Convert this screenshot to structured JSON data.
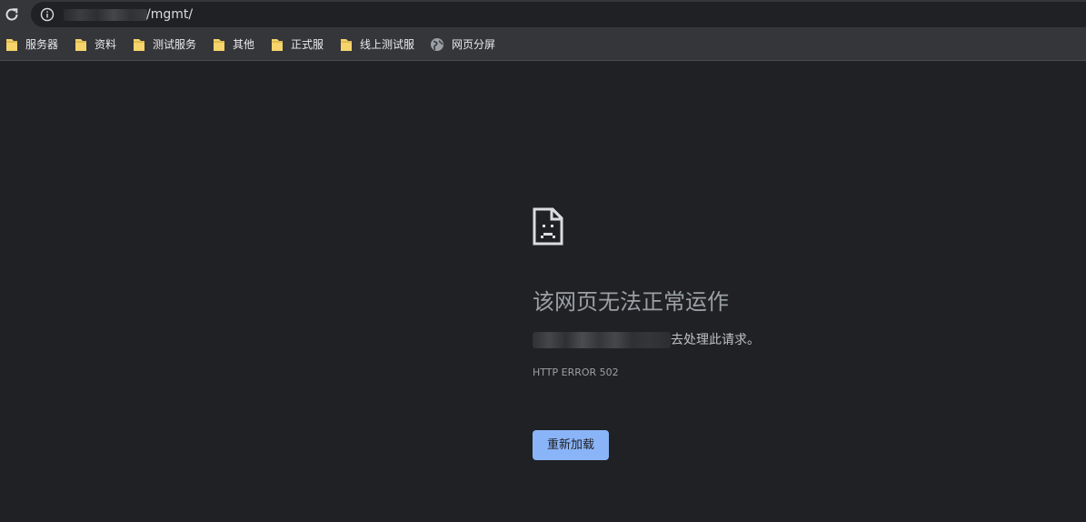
{
  "browser": {
    "address_bar": {
      "url_visible_suffix": "/mgmt/"
    },
    "bookmarks": [
      {
        "label": "服务器",
        "icon": "folder-icon"
      },
      {
        "label": "资料",
        "icon": "folder-icon"
      },
      {
        "label": "测试服务",
        "icon": "folder-icon"
      },
      {
        "label": "其他",
        "icon": "folder-icon"
      },
      {
        "label": "正式服",
        "icon": "folder-icon"
      },
      {
        "label": "线上测试服",
        "icon": "folder-icon"
      },
      {
        "label": "网页分屏",
        "icon": "globe-icon"
      }
    ]
  },
  "error_page": {
    "icon": "sad-page-icon",
    "title": "该网页无法正常运作",
    "description_suffix": "去处理此请求。",
    "error_code": "HTTP ERROR 502",
    "reload_label": "重新加载"
  },
  "colors": {
    "background": "#202124",
    "toolbar": "#35363a",
    "folder": "#f5d46b",
    "button": "#8ab4f8"
  }
}
